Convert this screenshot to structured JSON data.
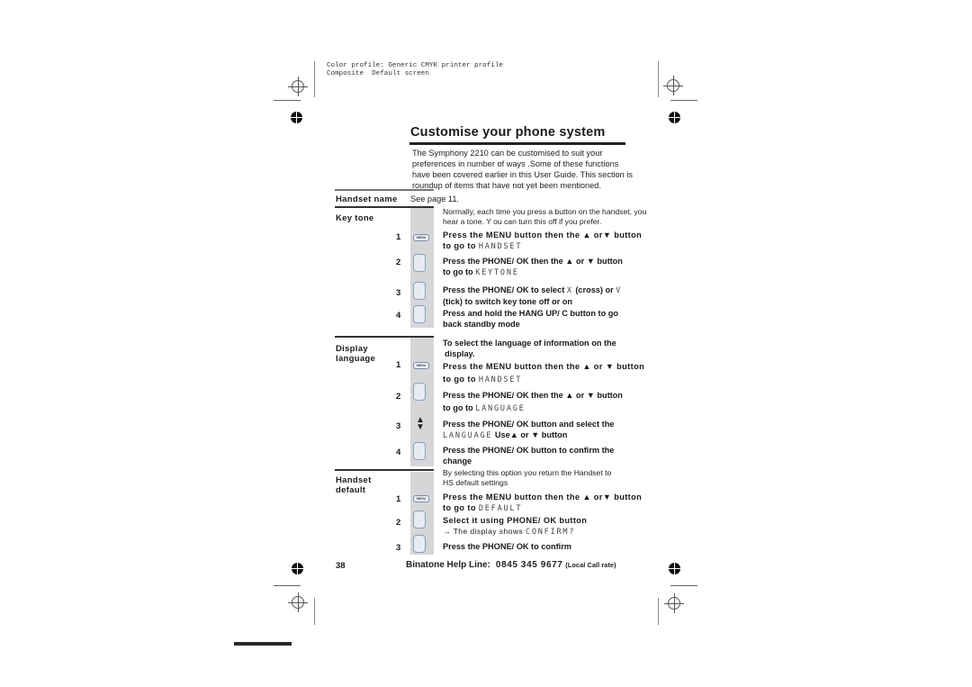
{
  "printer_profile": {
    "line1": "Color profile: Generic CMYK printer profile",
    "line2": "Composite  Default screen"
  },
  "page": {
    "title": "Customise your phone system",
    "intro": "The Symphony 2210 can be customised to suit your preferences in number of ways .Some of these functions have been covered earlier in this User Guide. This section is roundup of items that have not yet been mentioned.",
    "page_number": "38"
  },
  "sections": {
    "handset_name": {
      "label": "Handset name",
      "value": "See page 11."
    },
    "key_tone": {
      "label": "Key tone",
      "description": "Normally, each time you press a button on the handset, you hear a tone. Y ou can turn this off if you prefer.",
      "steps": [
        {
          "num": "1",
          "icon": "menu-button-icon",
          "text": "Press the MENU button then the ▲ or▼  button",
          "text2_prefix": "to go to ",
          "display": "HANDSET"
        },
        {
          "num": "2",
          "icon": "phone-ok-button-icon",
          "text": "Press the PHONE/ OK then the ▲ or ▼ button",
          "text2_prefix": "to go to ",
          "display": "KEYTONE"
        },
        {
          "num": "3",
          "icon": "phone-ok-button-icon",
          "text_prefix": "Press the PHONE/ OK to select ",
          "cross": "X",
          "text_mid": " (cross) or ",
          "tick": "V",
          "text2": "(tick) to switch key tone off or on"
        },
        {
          "num": "4",
          "icon": "hang-up-button-icon",
          "text": "Press and hold the HANG UP/ C button to go",
          "text2": "back standby mode"
        }
      ]
    },
    "display_language": {
      "label_line1": "Display",
      "label_line2": "language",
      "description_line1": "To select the language of information on the",
      "description_line2": "display.",
      "steps": [
        {
          "num": "1",
          "icon": "menu-button-icon",
          "text": "Press the MENU button then the ▲ or ▼ button",
          "text2_prefix": "to go to ",
          "display": "HANDSET"
        },
        {
          "num": "2",
          "icon": "phone-ok-button-icon",
          "text": "Press the PHONE/ OK then the ▲ or ▼ button",
          "text2_prefix": "to go to ",
          "display": "LANGUAGE"
        },
        {
          "num": "3",
          "icon": "up-down-arrows-icon",
          "text": "Press the PHONE/ OK button and select the",
          "display": "LANGUAGE",
          "text2_suffix": " Use▲  or ▼ button"
        },
        {
          "num": "4",
          "icon": "phone-ok-button-icon",
          "text": "Press the PHONE/ OK button to confirm the",
          "text2": "change"
        }
      ]
    },
    "handset_default": {
      "label_line1": "Handset",
      "label_line2": "default",
      "description_line1": "By selecting this option you return the Handset to",
      "description_line2": "HS default settings",
      "steps": [
        {
          "num": "1",
          "icon": "menu-button-icon",
          "text": "Press the MENU button then the ▲ or▼  button",
          "text2_prefix": "to go to ",
          "display": "DEFAULT"
        },
        {
          "num": "2",
          "icon": "phone-ok-button-icon",
          "text": "Select it using PHONE/ OK button",
          "text2_prefix": "→ The display shows ",
          "display": "CONFIRM?"
        },
        {
          "num": "3",
          "icon": "phone-ok-button-icon",
          "text": "Press the PHONE/ OK to confirm"
        }
      ]
    }
  },
  "footer": {
    "helpline_label": "Binatone Help Line:",
    "helpline_number": "0845 345 9677",
    "rate_note": "(Local Call rate)"
  },
  "icons": {
    "menu_key_label": "MENU",
    "arrows_up": "▲",
    "arrows_down": "▼"
  }
}
